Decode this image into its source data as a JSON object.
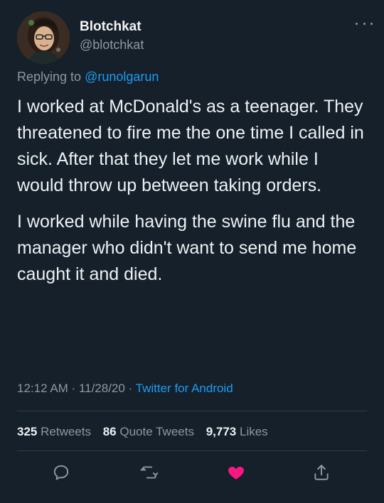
{
  "user": {
    "display_name": "Blotchkat",
    "handle": "@blotchkat",
    "avatar": "user-avatar-photo"
  },
  "reply": {
    "prefix": "Replying to ",
    "mention": "@runolgarun"
  },
  "tweet": {
    "paragraphs": [
      "I worked at McDonald's as a teenager. They threatened to fire me the one time I called in sick. After that they let me work while I would throw up between taking orders.",
      "I worked while having the swine flu and the manager who didn't want to send me home caught it and died."
    ],
    "time": "12:12 AM · 11/28/20 · ",
    "source": "Twitter for Android"
  },
  "stats": {
    "retweets_count": "325",
    "retweets_label": "Retweets",
    "quotes_count": "86",
    "quotes_label": "Quote Tweets",
    "likes_count": "9,773",
    "likes_label": "Likes"
  },
  "actions": {
    "reply_icon": "reply-icon",
    "retweet_icon": "retweet-icon",
    "like_icon": "heart-icon",
    "share_icon": "share-icon"
  },
  "colors": {
    "background": "#15202b",
    "accent": "#1d9bf0",
    "like": "#f91880",
    "muted": "#8b98a5"
  }
}
